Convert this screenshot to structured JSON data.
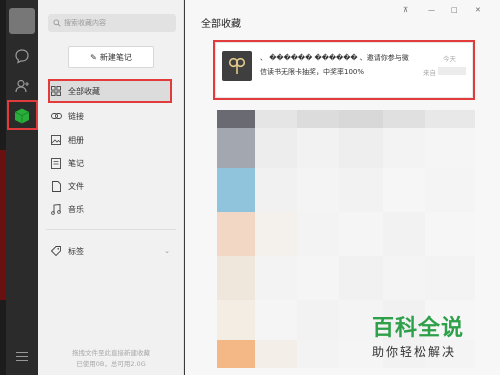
{
  "window": {
    "title": "全部收藏",
    "controls": {
      "pin": "⊼",
      "minimize": "—",
      "maximize": "□",
      "close": "✕"
    }
  },
  "nav": {
    "search_placeholder": "搜索收藏内容",
    "new_note_label": "新建笔记",
    "items": [
      {
        "label": "全部收藏",
        "icon": "grid-icon",
        "active": true
      },
      {
        "label": "链接",
        "icon": "link-icon"
      },
      {
        "label": "相册",
        "icon": "image-icon"
      },
      {
        "label": "笔记",
        "icon": "note-icon"
      },
      {
        "label": "文件",
        "icon": "file-icon"
      },
      {
        "label": "音乐",
        "icon": "music-icon"
      }
    ],
    "tags_label": "标签",
    "footer_line1": "拖拽文件至此直接新建收藏",
    "footer_line2": "已使用0B，总可用2.0G"
  },
  "favorite_item": {
    "title": "、 ������ ������ 、邀请你参与微",
    "subtitle": "信读书无限卡抽奖，中奖率100%",
    "time": "今天",
    "source_prefix": "来自"
  },
  "watermark": {
    "brand": "百科全说",
    "slogan": "助你轻松解决"
  },
  "colors": {
    "highlight": "#e23b3b",
    "favorites_green": "#2aae3a",
    "watermark_green": "#2ea04a"
  }
}
